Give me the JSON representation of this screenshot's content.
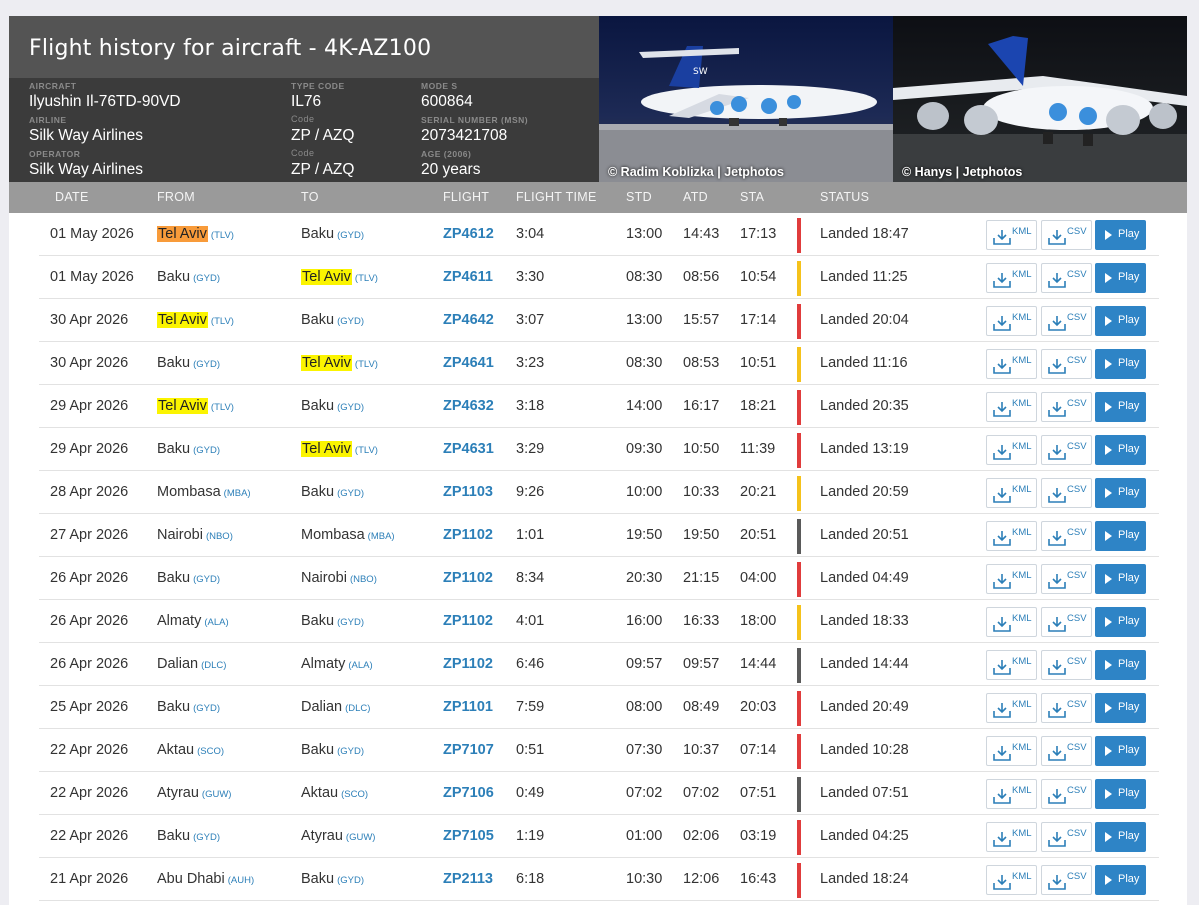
{
  "header": {
    "title": "Flight history for aircraft - 4K-AZ100",
    "fields": {
      "aircraft_label": "AIRCRAFT",
      "aircraft_value": "Ilyushin Il-76TD-90VD",
      "type_code_label": "TYPE CODE",
      "type_code_value": "IL76",
      "mode_s_label": "MODE S",
      "mode_s_value": "600864",
      "airline_label": "AIRLINE",
      "airline_value": "Silk Way Airlines",
      "airline_code_label": "Code",
      "airline_code_value": "ZP / AZQ",
      "serial_label": "SERIAL NUMBER (MSN)",
      "serial_value": "2073421708",
      "operator_label": "OPERATOR",
      "operator_value": "Silk Way Airlines",
      "operator_code_label": "Code",
      "operator_code_value": "ZP / AZQ",
      "age_label": "AGE (2006)",
      "age_value": "20 years"
    },
    "photos": [
      {
        "caption": "© Radim Koblizka | Jetphotos"
      },
      {
        "caption": "© Hanys | Jetphotos"
      }
    ]
  },
  "columns": {
    "date": "DATE",
    "from": "FROM",
    "to": "TO",
    "flight": "FLIGHT",
    "flight_time": "FLIGHT TIME",
    "std": "STD",
    "atd": "ATD",
    "sta": "STA",
    "status": "STATUS"
  },
  "buttons": {
    "kml": "KML",
    "csv": "CSV",
    "play": "Play"
  },
  "colors": {
    "red": "#e03c3c",
    "yellow": "#f5c21b",
    "gray": "#5a5a5a",
    "highlight": "#fbf400",
    "highlight_orange": "#f89b3a",
    "link": "#2c7fb8"
  },
  "rows": [
    {
      "date": "01 May 2026",
      "from": "Tel Aviv",
      "from_code": "(TLV)",
      "from_hl": "orange",
      "to": "Baku",
      "to_code": "(GYD)",
      "to_hl": "",
      "flight": "ZP4612",
      "flight_time": "3:04",
      "std": "13:00",
      "atd": "14:43",
      "sta": "17:13",
      "status_color": "red",
      "status": "Landed 18:47"
    },
    {
      "date": "01 May 2026",
      "from": "Baku",
      "from_code": "(GYD)",
      "from_hl": "",
      "to": "Tel Aviv",
      "to_code": "(TLV)",
      "to_hl": "yellow",
      "flight": "ZP4611",
      "flight_time": "3:30",
      "std": "08:30",
      "atd": "08:56",
      "sta": "10:54",
      "status_color": "yellow",
      "status": "Landed 11:25"
    },
    {
      "date": "30 Apr 2026",
      "from": "Tel Aviv",
      "from_code": "(TLV)",
      "from_hl": "yellow",
      "to": "Baku",
      "to_code": "(GYD)",
      "to_hl": "",
      "flight": "ZP4642",
      "flight_time": "3:07",
      "std": "13:00",
      "atd": "15:57",
      "sta": "17:14",
      "status_color": "red",
      "status": "Landed 20:04"
    },
    {
      "date": "30 Apr 2026",
      "from": "Baku",
      "from_code": "(GYD)",
      "from_hl": "",
      "to": "Tel Aviv",
      "to_code": "(TLV)",
      "to_hl": "yellow",
      "flight": "ZP4641",
      "flight_time": "3:23",
      "std": "08:30",
      "atd": "08:53",
      "sta": "10:51",
      "status_color": "yellow",
      "status": "Landed 11:16"
    },
    {
      "date": "29 Apr 2026",
      "from": "Tel Aviv",
      "from_code": "(TLV)",
      "from_hl": "yellow",
      "to": "Baku",
      "to_code": "(GYD)",
      "to_hl": "",
      "flight": "ZP4632",
      "flight_time": "3:18",
      "std": "14:00",
      "atd": "16:17",
      "sta": "18:21",
      "status_color": "red",
      "status": "Landed 20:35"
    },
    {
      "date": "29 Apr 2026",
      "from": "Baku",
      "from_code": "(GYD)",
      "from_hl": "",
      "to": "Tel Aviv",
      "to_code": "(TLV)",
      "to_hl": "yellow",
      "flight": "ZP4631",
      "flight_time": "3:29",
      "std": "09:30",
      "atd": "10:50",
      "sta": "11:39",
      "status_color": "red",
      "status": "Landed 13:19"
    },
    {
      "date": "28 Apr 2026",
      "from": "Mombasa",
      "from_code": "(MBA)",
      "from_hl": "",
      "to": "Baku",
      "to_code": "(GYD)",
      "to_hl": "",
      "flight": "ZP1103",
      "flight_time": "9:26",
      "std": "10:00",
      "atd": "10:33",
      "sta": "20:21",
      "status_color": "yellow",
      "status": "Landed 20:59"
    },
    {
      "date": "27 Apr 2026",
      "from": "Nairobi",
      "from_code": "(NBO)",
      "from_hl": "",
      "to": "Mombasa",
      "to_code": "(MBA)",
      "to_hl": "",
      "flight": "ZP1102",
      "flight_time": "1:01",
      "std": "19:50",
      "atd": "19:50",
      "sta": "20:51",
      "status_color": "gray",
      "status": "Landed 20:51"
    },
    {
      "date": "26 Apr 2026",
      "from": "Baku",
      "from_code": "(GYD)",
      "from_hl": "",
      "to": "Nairobi",
      "to_code": "(NBO)",
      "to_hl": "",
      "flight": "ZP1102",
      "flight_time": "8:34",
      "std": "20:30",
      "atd": "21:15",
      "sta": "04:00",
      "status_color": "red",
      "status": "Landed 04:49"
    },
    {
      "date": "26 Apr 2026",
      "from": "Almaty",
      "from_code": "(ALA)",
      "from_hl": "",
      "to": "Baku",
      "to_code": "(GYD)",
      "to_hl": "",
      "flight": "ZP1102",
      "flight_time": "4:01",
      "std": "16:00",
      "atd": "16:33",
      "sta": "18:00",
      "status_color": "yellow",
      "status": "Landed 18:33"
    },
    {
      "date": "26 Apr 2026",
      "from": "Dalian",
      "from_code": "(DLC)",
      "from_hl": "",
      "to": "Almaty",
      "to_code": "(ALA)",
      "to_hl": "",
      "flight": "ZP1102",
      "flight_time": "6:46",
      "std": "09:57",
      "atd": "09:57",
      "sta": "14:44",
      "status_color": "gray",
      "status": "Landed 14:44"
    },
    {
      "date": "25 Apr 2026",
      "from": "Baku",
      "from_code": "(GYD)",
      "from_hl": "",
      "to": "Dalian",
      "to_code": "(DLC)",
      "to_hl": "",
      "flight": "ZP1101",
      "flight_time": "7:59",
      "std": "08:00",
      "atd": "08:49",
      "sta": "20:03",
      "status_color": "red",
      "status": "Landed 20:49"
    },
    {
      "date": "22 Apr 2026",
      "from": "Aktau",
      "from_code": "(SCO)",
      "from_hl": "",
      "to": "Baku",
      "to_code": "(GYD)",
      "to_hl": "",
      "flight": "ZP7107",
      "flight_time": "0:51",
      "std": "07:30",
      "atd": "10:37",
      "sta": "07:14",
      "status_color": "red",
      "status": "Landed 10:28"
    },
    {
      "date": "22 Apr 2026",
      "from": "Atyrau",
      "from_code": "(GUW)",
      "from_hl": "",
      "to": "Aktau",
      "to_code": "(SCO)",
      "to_hl": "",
      "flight": "ZP7106",
      "flight_time": "0:49",
      "std": "07:02",
      "atd": "07:02",
      "sta": "07:51",
      "status_color": "gray",
      "status": "Landed 07:51"
    },
    {
      "date": "22 Apr 2026",
      "from": "Baku",
      "from_code": "(GYD)",
      "from_hl": "",
      "to": "Atyrau",
      "to_code": "(GUW)",
      "to_hl": "",
      "flight": "ZP7105",
      "flight_time": "1:19",
      "std": "01:00",
      "atd": "02:06",
      "sta": "03:19",
      "status_color": "red",
      "status": "Landed 04:25"
    },
    {
      "date": "21 Apr 2026",
      "from": "Abu Dhabi",
      "from_code": "(AUH)",
      "from_hl": "",
      "to": "Baku",
      "to_code": "(GYD)",
      "to_hl": "",
      "flight": "ZP2113",
      "flight_time": "6:18",
      "std": "10:30",
      "atd": "12:06",
      "sta": "16:43",
      "status_color": "red",
      "status": "Landed 18:24"
    }
  ]
}
